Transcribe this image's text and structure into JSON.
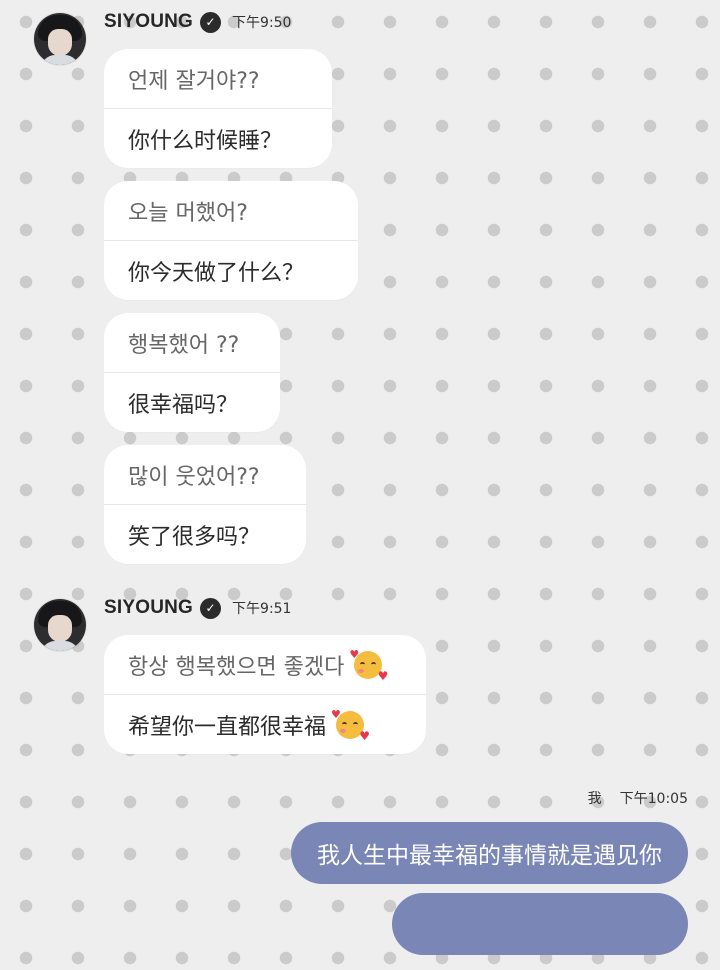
{
  "groups": [
    {
      "sender": "SIYOUNG",
      "time": "下午9:50",
      "bubbles": [
        {
          "ko": "언제 잘거야??",
          "cn": "你什么时候睡？"
        },
        {
          "ko": "오늘 머했어?",
          "cn": "你今天做了什么？"
        },
        {
          "ko": "행복했어 ??",
          "cn": "很幸福吗？"
        },
        {
          "ko": "많이 웃었어??",
          "cn": "笑了很多吗？"
        }
      ]
    },
    {
      "sender": "SIYOUNG",
      "time": "下午9:51",
      "bubbles": [
        {
          "ko": "항상 행복했으면 좋겠다",
          "cn": "希望你一直都很幸福",
          "emoji": "smiling-face-with-hearts-icon"
        }
      ]
    }
  ],
  "me": {
    "label": "我",
    "time": "下午10:05",
    "messages": [
      {
        "text": "我人生中最幸福的事情就是遇见你"
      },
      {
        "text": ""
      }
    ]
  },
  "colors": {
    "my_bubble": "#7a86b6",
    "their_bubble": "#ffffff",
    "background": "#eeeeee",
    "dots": "#cbcbcb"
  }
}
